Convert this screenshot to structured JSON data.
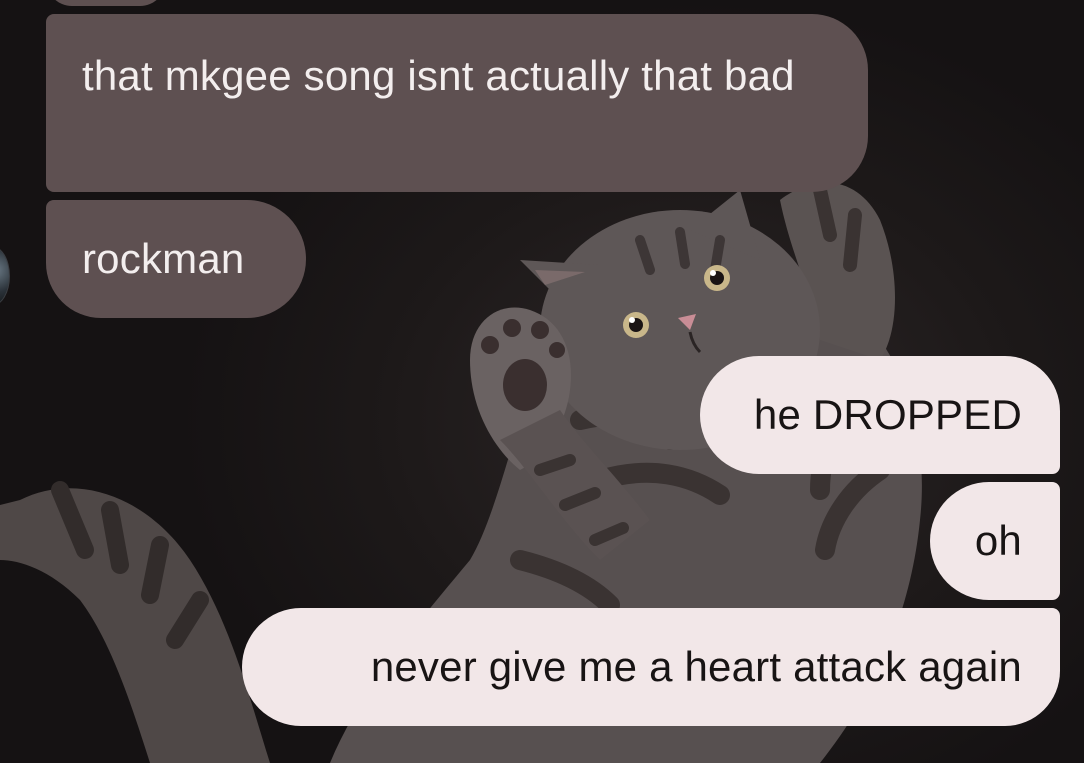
{
  "wallpaper": {
    "icon": "cat-illustration",
    "colors": {
      "background": "#1a1617",
      "cat_body": "#5a5352",
      "cat_stripe": "#3a3332"
    }
  },
  "colors": {
    "incoming_bubble": "#5e5051",
    "incoming_text": "#f3eeee",
    "outgoing_bubble": "#f2e7e8",
    "outgoing_text": "#181414"
  },
  "messages": [
    {
      "direction": "incoming",
      "text": "that mkgee song isnt actually that bad"
    },
    {
      "direction": "incoming",
      "text": "rockman"
    },
    {
      "direction": "outgoing",
      "text": "he DROPPED"
    },
    {
      "direction": "outgoing",
      "text": "oh"
    },
    {
      "direction": "outgoing",
      "text": "never give me a heart attack again"
    }
  ],
  "sender": {
    "avatar_icon": "contact-avatar-icon"
  }
}
